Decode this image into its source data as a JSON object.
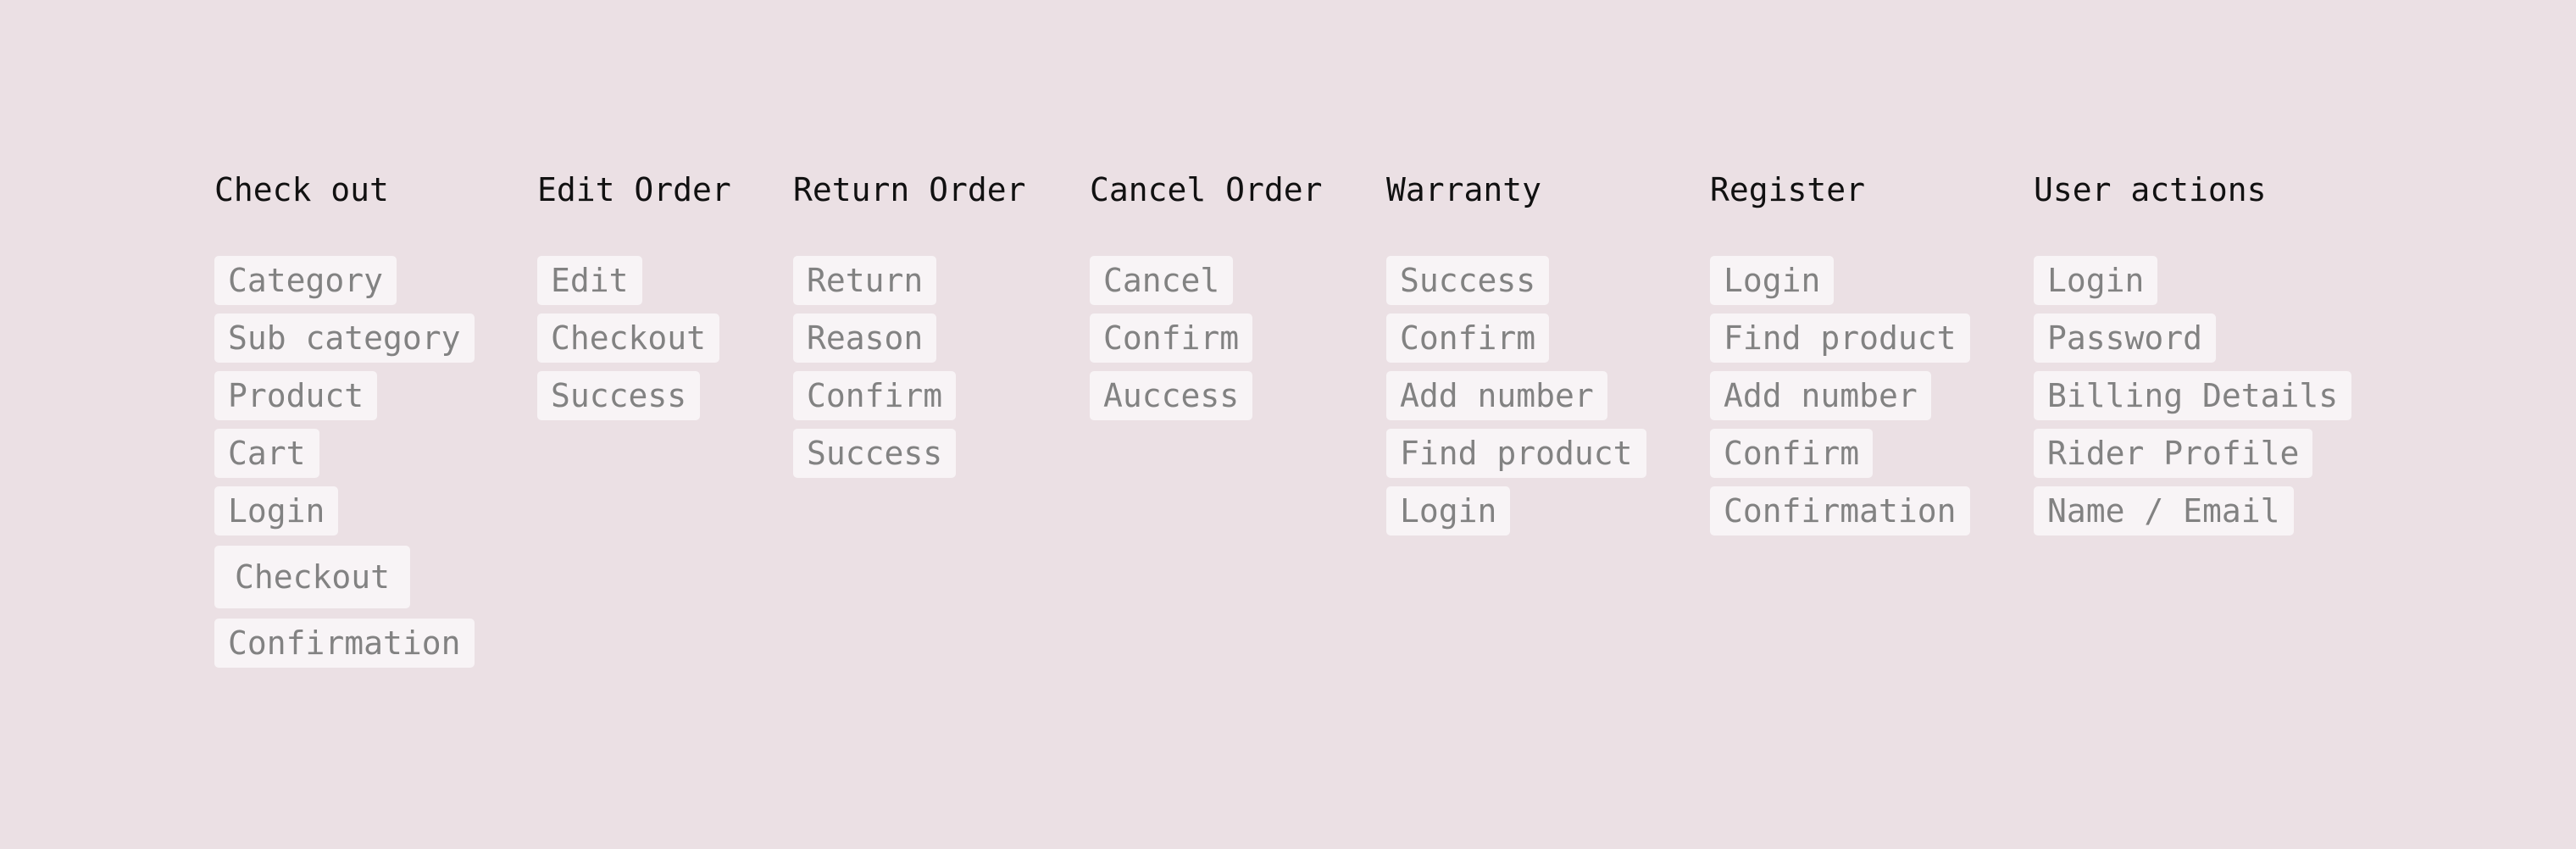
{
  "colors": {
    "background": "#ebe0e4",
    "chip_background": "#f8f4f6",
    "chip_text": "#828282",
    "heading_text": "#111111"
  },
  "columns": [
    {
      "title": "Check out",
      "items": [
        "Category",
        "Sub category",
        "Product",
        "Cart",
        "Login",
        "Checkout",
        "Confirmation"
      ]
    },
    {
      "title": "Edit Order",
      "items": [
        "Edit",
        "Checkout",
        "Success"
      ]
    },
    {
      "title": "Return Order",
      "items": [
        "Return",
        "Reason",
        "Confirm",
        "Success"
      ]
    },
    {
      "title": "Cancel Order",
      "items": [
        "Cancel",
        "Confirm",
        "Auccess"
      ]
    },
    {
      "title": "Warranty",
      "items": [
        "Success",
        "Confirm",
        "Add number",
        "Find product",
        "Login"
      ]
    },
    {
      "title": "Register",
      "items": [
        "Login",
        "Find product",
        "Add number",
        "Confirm",
        "Confirmation"
      ]
    },
    {
      "title": "User actions",
      "items": [
        "Login",
        "Password",
        "Billing Details",
        "Rider Profile",
        "Name / Email"
      ]
    }
  ]
}
